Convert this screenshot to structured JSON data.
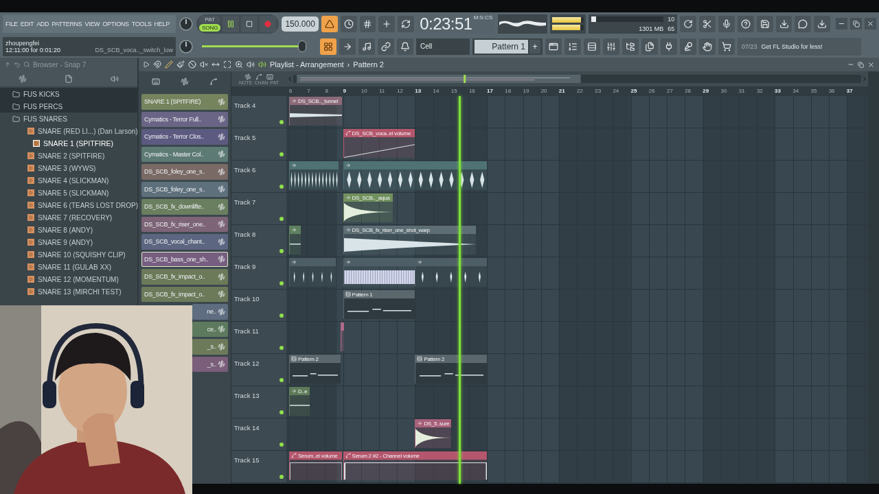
{
  "menu": [
    "FILE",
    "EDIT",
    "ADD",
    "PATTERNS",
    "VIEW",
    "OPTIONS",
    "TOOLS",
    "HELP"
  ],
  "hint": {
    "user": "zhoupengfei",
    "time": "12:11:00 for 0:01:20",
    "file": "DS_SCB_voca.._switch_low"
  },
  "modes": [
    {
      "label": "PAT",
      "selected": false
    },
    {
      "label": "SONG",
      "selected": true
    }
  ],
  "playing": true,
  "tempo": "150.000",
  "toggles_top": [
    {
      "on": true
    },
    {
      "on": false
    },
    {
      "on": false
    },
    {
      "on": false
    },
    {
      "on": false
    }
  ],
  "time": {
    "value": "0:23:51",
    "unit": "M:S:CS"
  },
  "output_meter": [
    {
      "level": 0.92
    },
    {
      "level": 0.9
    }
  ],
  "cpu": {
    "level": 0.07,
    "voices": "10",
    "memory": "1301 MB",
    "polyphony": "65"
  },
  "master_volume": {
    "level": 0.93
  },
  "toggles_bottom": [
    {
      "on": true
    },
    {
      "on": false
    },
    {
      "on": false
    },
    {
      "on": false
    },
    {
      "on": false
    }
  ],
  "snap": "Cell",
  "pattern": {
    "name": "Pattern 1",
    "add": "+"
  },
  "news": {
    "count": "07/23",
    "text": "Get FL Studio for less!"
  },
  "browser": {
    "title": "Browser - Snap 7",
    "items": [
      {
        "label": "FUS KICKS",
        "kind": "folder",
        "expanded": false
      },
      {
        "label": "FUS PERCS",
        "kind": "folder",
        "expanded": false
      },
      {
        "label": "FUS SNARES",
        "kind": "folder",
        "expanded": true,
        "children": [
          {
            "label": "SNARE (RED LI...) (Dan Larson)",
            "kind": "file",
            "selected": false
          },
          {
            "label": "SNARE 1 (SPITFIRE)",
            "kind": "file",
            "selected": true
          },
          {
            "label": "SNARE 2 (SPITFIRE)",
            "kind": "file",
            "selected": false
          },
          {
            "label": "SNARE 3 (WYWS)",
            "kind": "file",
            "selected": false
          },
          {
            "label": "SNARE 4 (SLICKMAN)",
            "kind": "file",
            "selected": false
          },
          {
            "label": "SNARE 5 (SLICKMAN)",
            "kind": "file",
            "selected": false
          },
          {
            "label": "SNARE 6 (TEARS LOST DROP)",
            "kind": "file",
            "selected": false
          },
          {
            "label": "SNARE 7 (RECOVERY)",
            "kind": "file",
            "selected": false
          },
          {
            "label": "SNARE 8 (ANDY)",
            "kind": "file",
            "selected": false
          },
          {
            "label": "SNARE 9 (ANDY)",
            "kind": "file",
            "selected": false
          },
          {
            "label": "SNARE 10 (SQUISHY CLIP)",
            "kind": "file",
            "selected": false
          },
          {
            "label": "SNARE 11 (GULAB XX)",
            "kind": "file",
            "selected": false
          },
          {
            "label": "SNARE 12 (MOMENTUM)",
            "kind": "file",
            "selected": false
          },
          {
            "label": "SNARE 13 (MIRCHI TEST)",
            "kind": "file",
            "selected": false
          }
        ]
      }
    ]
  },
  "playlist": {
    "title": "Playlist - Arrangement",
    "separator": "›",
    "pattern": "Pattern 2",
    "picker": [
      {
        "name": "SNARE 1 (SPITFIRE)",
        "color": "#76845e",
        "selected": false,
        "covered": false
      },
      {
        "name": "Cymatics - Terror Full..",
        "color": "#6a6585",
        "selected": false,
        "covered": false
      },
      {
        "name": "Cymatics - Terror Clos..",
        "color": "#5c5a80",
        "selected": false,
        "covered": false
      },
      {
        "name": "Cymatics - Master Col..",
        "color": "#5d7a74",
        "selected": false,
        "covered": false
      },
      {
        "name": "DS_SCB_foley_one_s..",
        "color": "#7a6a66",
        "selected": false,
        "covered": false
      },
      {
        "name": "DS_SCB_foley_one_s..",
        "color": "#5e707c",
        "selected": false,
        "covered": false
      },
      {
        "name": "DS_SCB_fx_downlifte..",
        "color": "#6a7e60",
        "selected": false,
        "covered": false
      },
      {
        "name": "DS_SCB_fx_riser_one..",
        "color": "#7d6476",
        "selected": false,
        "covered": false
      },
      {
        "name": "DS_SCB_vocal_chant..",
        "color": "#5c6680",
        "selected": false,
        "covered": false
      },
      {
        "name": "DS_SCB_bass_one_sh..",
        "color": "#765e80",
        "selected": true,
        "covered": false
      },
      {
        "name": "DS_SCB_fx_impact_o..",
        "color": "#6c7a5a",
        "selected": false,
        "covered": false
      },
      {
        "name": "DS_SCB_fx_impact_o..",
        "color": "#6c7a5a",
        "selected": false,
        "covered": false
      },
      {
        "name": "ne..",
        "color": "#5e6d80",
        "selected": false,
        "covered": true
      },
      {
        "name": "ce..",
        "color": "#5e7a5e",
        "selected": false,
        "covered": true
      },
      {
        "name": "_s..",
        "color": "#6c7a5a",
        "selected": false,
        "covered": true
      },
      {
        "name": "_s..",
        "color": "#7a5e7a",
        "selected": false,
        "covered": true
      }
    ],
    "view_modes": [
      "NOTE",
      "CHAN",
      "PAT"
    ],
    "ruler": [
      "6",
      "7",
      "8",
      "9",
      "10",
      "11",
      "12",
      "13",
      "14",
      "15",
      "16",
      "17",
      "18",
      "19",
      "20",
      "21",
      "22",
      "23",
      "24",
      "25",
      "26",
      "27",
      "28",
      "29",
      "30",
      "31",
      "32",
      "33",
      "34",
      "35",
      "36",
      "37"
    ],
    "tracks": [
      {
        "name": "Track 4",
        "active": true,
        "clips": [
          {
            "kind": "audio",
            "title": "DS_SCB.._tunnel",
            "color": "#8c6a78"
          }
        ]
      },
      {
        "name": "Track 5",
        "active": true,
        "clips": [
          {
            "kind": "automation",
            "title": "DS_SCB_voca..el volume",
            "color": "#b4566c"
          }
        ]
      },
      {
        "name": "Track 6",
        "active": true,
        "clips": [
          {
            "kind": "audio",
            "color": "#4f7274"
          },
          {
            "kind": "audio",
            "color": "#4f7274"
          }
        ]
      },
      {
        "name": "Track 7",
        "active": true,
        "clips": [
          {
            "kind": "audio",
            "title": "DS_SCB.._aqua",
            "color": "#71905e"
          }
        ]
      },
      {
        "name": "Track 8",
        "active": true,
        "clips": [
          {
            "kind": "audio",
            "color": "#5e8060"
          },
          {
            "kind": "audio",
            "title": "DS_SCB_fx_riser_one_shot_warp",
            "color": "#5d6e74"
          }
        ]
      },
      {
        "name": "Track 9",
        "active": true,
        "clips": [
          {
            "kind": "audio",
            "color": "#4e5e66"
          },
          {
            "kind": "audio",
            "color": "#4e5e66"
          },
          {
            "kind": "audio",
            "color": "#4e5e66"
          }
        ]
      },
      {
        "name": "Track 10",
        "active": true,
        "clips": [
          {
            "kind": "pattern",
            "title": "Pattern 1",
            "color": "#5a676d"
          }
        ]
      },
      {
        "name": "Track 11",
        "active": true,
        "clips": [
          {
            "kind": "audio",
            "color": "#b06a8a"
          }
        ]
      },
      {
        "name": "Track 12",
        "active": true,
        "clips": [
          {
            "kind": "pattern",
            "title": "Pattern 2",
            "color": "#5a676d"
          },
          {
            "kind": "pattern",
            "title": "Pattern 2",
            "color": "#5a676d"
          }
        ]
      },
      {
        "name": "Track 13",
        "active": true,
        "clips": [
          {
            "kind": "audio",
            "title": "D..e",
            "color": "#5e7a58"
          }
        ]
      },
      {
        "name": "Track 14",
        "active": true,
        "clips": [
          {
            "kind": "audio",
            "title": "DS_5..sure",
            "color": "#a8607a"
          }
        ]
      },
      {
        "name": "Track 15",
        "active": true,
        "clips": [
          {
            "kind": "automation",
            "title": "Serum..el volume",
            "color": "#b4566c"
          },
          {
            "kind": "automation",
            "title": "Serum 2 #2 - Channel volume",
            "color": "#b4566c"
          }
        ]
      }
    ]
  }
}
